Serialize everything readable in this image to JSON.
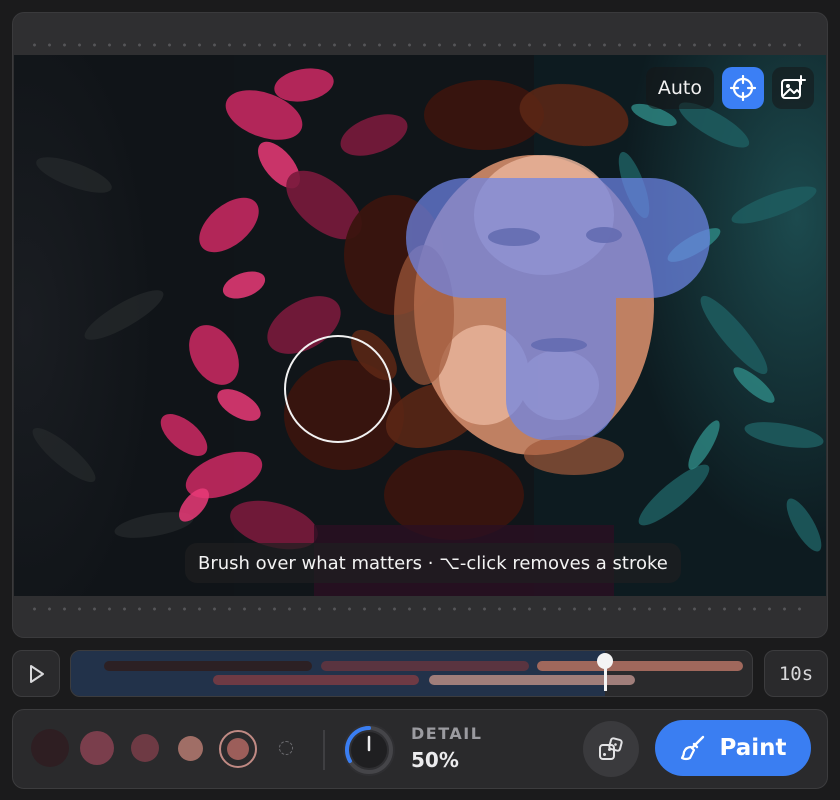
{
  "canvas": {
    "auto_label": "Auto",
    "hint": "Brush over what matters · ⌥-click removes a stroke"
  },
  "timeline": {
    "playhead_fraction": 0.8,
    "duration": "10s"
  },
  "palette": {
    "swatches": [
      {
        "color": "#2e1e22"
      },
      {
        "color": "#7a3e4c"
      },
      {
        "color": "#6e3a44"
      },
      {
        "color": "#a06e66"
      },
      {
        "color": "#9c5e5a",
        "selected": true
      }
    ]
  },
  "detail": {
    "label": "DETAIL",
    "value_text": "50%",
    "value": 0.5
  },
  "paint_button": {
    "label": "Paint"
  },
  "colors": {
    "accent": "#3a7ef2",
    "mask": "#6e86e8"
  }
}
